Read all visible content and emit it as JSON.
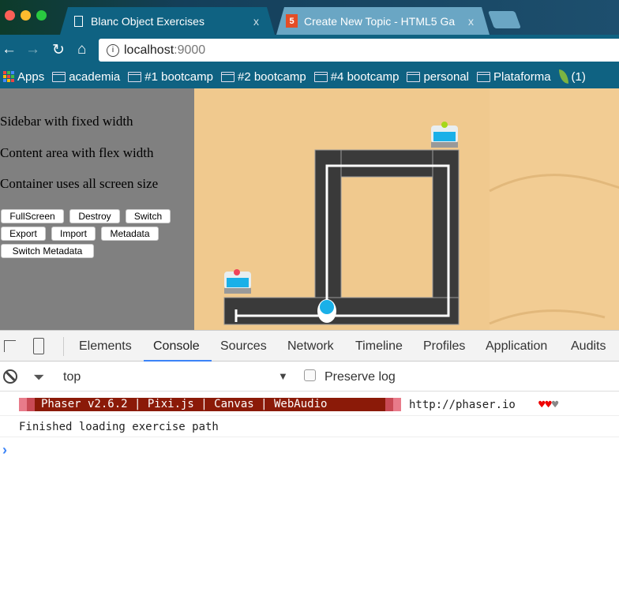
{
  "browser": {
    "tabs": [
      {
        "title": "Blanc Object Exercises",
        "icon": "page-icon",
        "active": true
      },
      {
        "title": "Create New Topic - HTML5 Ga",
        "icon": "html5-icon",
        "active": false
      }
    ],
    "close_glyph": "x",
    "url_host": "localhost",
    "url_port": ":9000",
    "bookmarks": [
      {
        "label": "Apps",
        "icon": "apps-grid-icon"
      },
      {
        "label": "academia",
        "icon": "folder-icon"
      },
      {
        "label": "#1 bootcamp",
        "icon": "folder-icon"
      },
      {
        "label": "#2 bootcamp",
        "icon": "folder-icon"
      },
      {
        "label": "#4 bootcamp",
        "icon": "folder-icon"
      },
      {
        "label": "personal",
        "icon": "folder-icon"
      },
      {
        "label": "Plataforma",
        "icon": "folder-icon"
      },
      {
        "label": "(1)",
        "icon": "leaf-icon"
      }
    ]
  },
  "sidebar": {
    "lines": [
      "Sidebar with fixed width",
      "Content area with flex width",
      "Container uses all screen size"
    ],
    "buttons": [
      "FullScreen",
      "Destroy",
      "Switch",
      "Export",
      "Import",
      "Metadata",
      "Switch Metadata"
    ]
  },
  "devtools": {
    "tabs": [
      "Elements",
      "Console",
      "Sources",
      "Network",
      "Timeline",
      "Profiles",
      "Application",
      "Audits"
    ],
    "active_tab": "Console",
    "context": "top",
    "preserve_log": "Preserve log",
    "preserve_log_checked": false,
    "console": {
      "banner": "Phaser v2.6.2 | Pixi.js | Canvas | WebAudio",
      "banner_link": "http://phaser.io",
      "hearts": "♥♥",
      "heart_grey": "♥",
      "message": "Finished loading exercise path",
      "prompt": "›"
    }
  },
  "colors": {
    "chrome": "#0f6282",
    "banner_bg": "#8b1a08",
    "banner_edge": "#e87b8a",
    "accent": "#3b83f7",
    "sand": "#f0c98e",
    "track": "#3a3a3a",
    "robot": "#1ab0e8"
  }
}
